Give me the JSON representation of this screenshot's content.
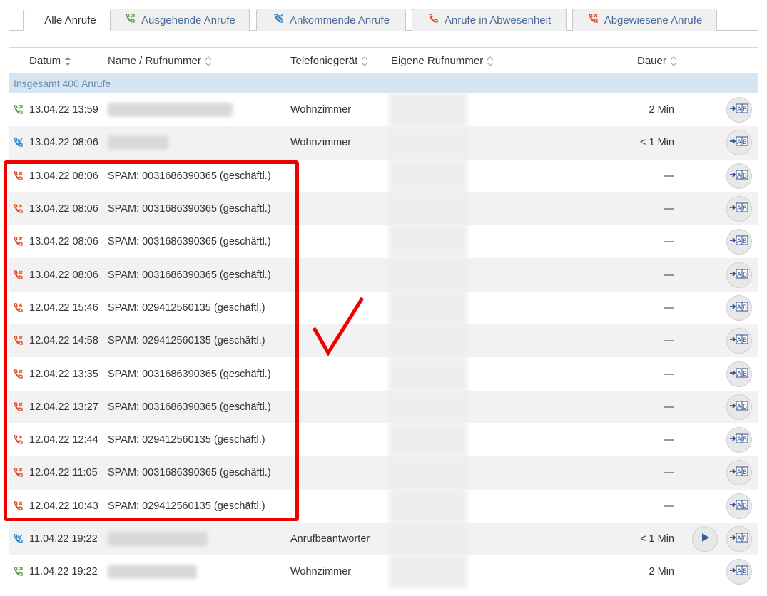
{
  "tabs": [
    {
      "label": "Alle Anrufe",
      "icon": "none",
      "active": true
    },
    {
      "label": "Ausgehende Anrufe",
      "icon": "outgoing-call-icon",
      "active": false
    },
    {
      "label": "Ankommende Anrufe",
      "icon": "incoming-call-icon",
      "active": false
    },
    {
      "label": "Anrufe in Abwesenheit",
      "icon": "missed-call-icon",
      "active": false
    },
    {
      "label": "Abgewiesene Anrufe",
      "icon": "rejected-call-icon",
      "active": false
    }
  ],
  "columns": {
    "date": "Datum",
    "name": "Name / Rufnummer",
    "device": "Telefoniegerät",
    "own_number": "Eigene Rufnummer",
    "duration": "Dauer"
  },
  "summary": "Insgesamt 400 Anrufe",
  "colors": {
    "outgoing": "#5aa845",
    "incoming": "#2e86c9",
    "rejected": "#e0502a",
    "summary_bg": "#d6e5f2",
    "annotation": "#ee0000"
  },
  "rows": [
    {
      "type": "outgoing",
      "date": "13.04.22 13:59",
      "name": "",
      "device": "Wohnzimmer",
      "duration": "2 Min"
    },
    {
      "type": "incoming",
      "date": "13.04.22 08:06",
      "name": "",
      "device": "Wohnzimmer",
      "duration": "< 1 Min"
    },
    {
      "type": "rejected",
      "date": "13.04.22 08:06",
      "name": "SPAM: 0031686390365 (geschäftl.)",
      "device": "",
      "duration": "—"
    },
    {
      "type": "rejected",
      "date": "13.04.22 08:06",
      "name": "SPAM: 0031686390365 (geschäftl.)",
      "device": "",
      "duration": "—"
    },
    {
      "type": "rejected",
      "date": "13.04.22 08:06",
      "name": "SPAM: 0031686390365 (geschäftl.)",
      "device": "",
      "duration": "—"
    },
    {
      "type": "rejected",
      "date": "13.04.22 08:06",
      "name": "SPAM: 0031686390365 (geschäftl.)",
      "device": "",
      "duration": "—"
    },
    {
      "type": "rejected",
      "date": "12.04.22 15:46",
      "name": "SPAM: 029412560135 (geschäftl.)",
      "device": "",
      "duration": "—"
    },
    {
      "type": "rejected",
      "date": "12.04.22 14:58",
      "name": "SPAM: 029412560135 (geschäftl.)",
      "device": "",
      "duration": "—"
    },
    {
      "type": "rejected",
      "date": "12.04.22 13:35",
      "name": "SPAM: 0031686390365 (geschäftl.)",
      "device": "",
      "duration": "—"
    },
    {
      "type": "rejected",
      "date": "12.04.22 13:27",
      "name": "SPAM: 0031686390365 (geschäftl.)",
      "device": "",
      "duration": "—"
    },
    {
      "type": "rejected",
      "date": "12.04.22 12:44",
      "name": "SPAM: 029412560135 (geschäftl.)",
      "device": "",
      "duration": "—"
    },
    {
      "type": "rejected",
      "date": "12.04.22 11:05",
      "name": "SPAM: 0031686390365 (geschäftl.)",
      "device": "",
      "duration": "—"
    },
    {
      "type": "rejected",
      "date": "12.04.22 10:43",
      "name": "SPAM: 029412560135 (geschäftl.)",
      "device": "",
      "duration": "—"
    },
    {
      "type": "incoming",
      "date": "11.04.22 19:22",
      "name": "",
      "device": "Anrufbeantworter",
      "duration": "< 1 Min",
      "has_play": true
    },
    {
      "type": "outgoing",
      "date": "11.04.22 19:22",
      "name": "",
      "device": "Wohnzimmer",
      "duration": "2 Min"
    }
  ]
}
